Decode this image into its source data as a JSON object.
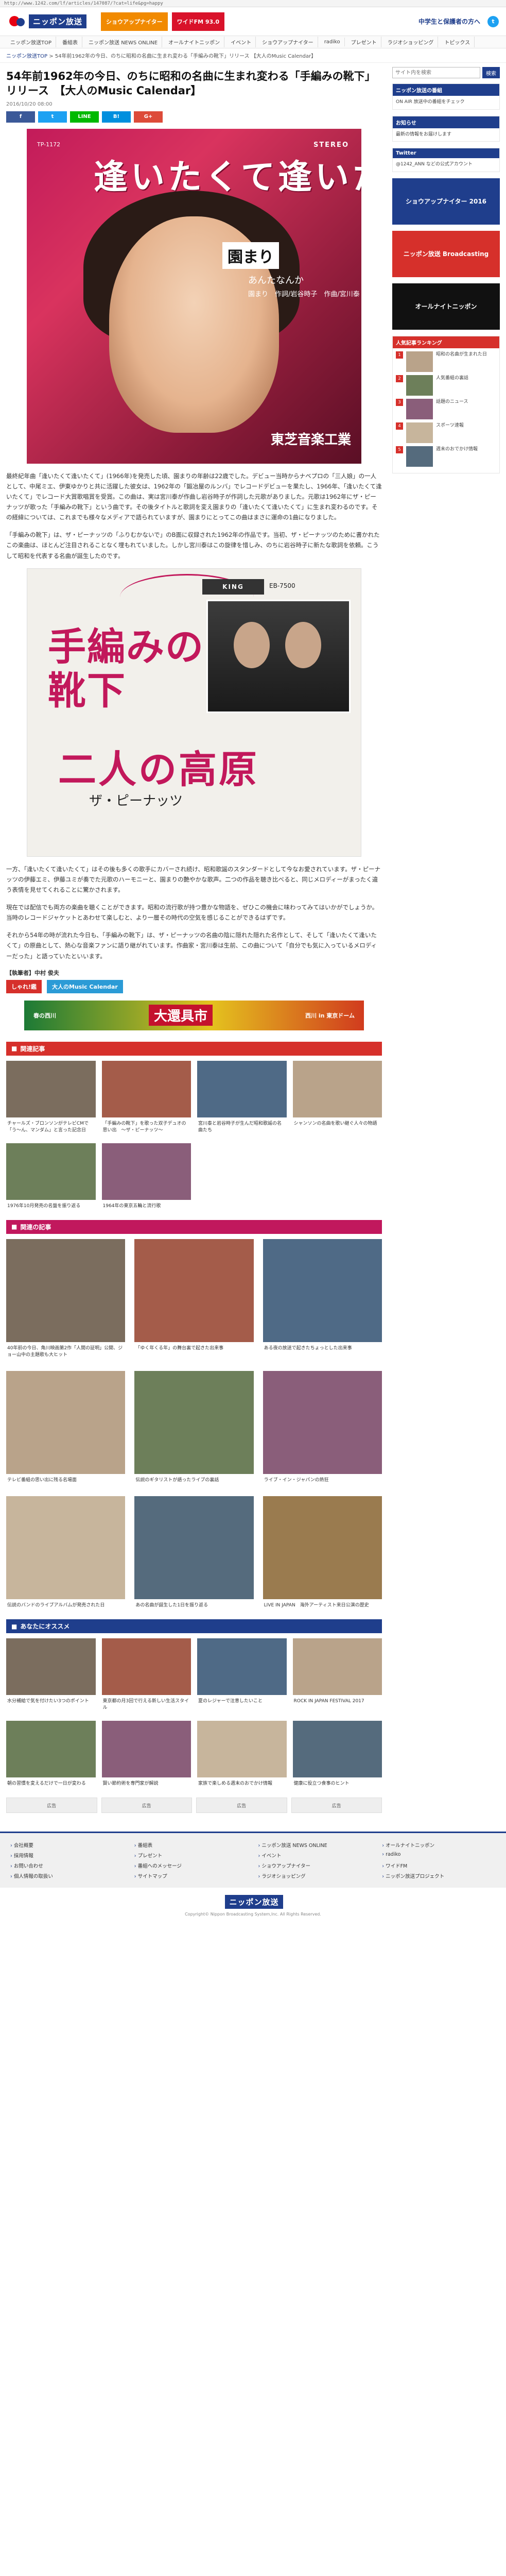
{
  "browser": {
    "url": "http://www.1242.com/lf/articles/147087/?cat=life&pg=happy"
  },
  "header": {
    "logo": "ニッポン放送",
    "banners": [
      {
        "text": "ショウアップナイター",
        "color": "#f18a00"
      },
      {
        "text": "ワイドFM 93.0",
        "color": "#d9122a"
      }
    ],
    "tagline": "中学生と保護者の方へ"
  },
  "nav": {
    "items": [
      "ニッポン放送TOP",
      "番組表",
      "ニッポン放送 NEWS ONLINE",
      "オールナイトニッポン",
      "イベント",
      "ショウアップナイター",
      "radiko",
      "プレゼント",
      "ラジオショッピング",
      "トピックス"
    ]
  },
  "breadcrumb": {
    "home": "ニッポン放送TOP",
    "sep": " > ",
    "current": "54年前1962年の今日、のちに昭和の名曲に生まれ変わる「手編みの靴下」リリース 【大人のMusic Calendar】"
  },
  "article": {
    "title": "54年前1962年の今日、のちに昭和の名曲に生まれ変わる「手編みの靴下」リリース　【大人のMusic Calendar】",
    "date": "2016/10/20 08:00",
    "share": [
      {
        "label": "f",
        "color": "#3b5998"
      },
      {
        "label": "t",
        "color": "#1da1f2"
      },
      {
        "label": "LINE",
        "color": "#00b900"
      },
      {
        "label": "B!",
        "color": "#008fde"
      },
      {
        "label": "G+",
        "color": "#dd4b39"
      }
    ],
    "sleeve1": {
      "title": "逢いたくて逢いたくて",
      "artist": "園まり",
      "sub": "あんたなんか",
      "credit": "園まり　作詞/岩谷時子　作曲/宮川泰",
      "label": "東芝音楽工業",
      "stereo": "STEREO",
      "catalog": "TP-1172"
    },
    "para1": "最終紀年曲「逢いたくて逢いたくて」(1966年)を発売した頃、園まりの年齢は22歳でした。デビュー当時からナベプロの「三人娘」の一人として、中尾ミエ、伊東ゆかりと共に活躍した彼女は、1962年の「鍛冶屋のルンバ」でレコードデビューを果たし、1966年、「逢いたくて逢いたくて」でレコード大賞歌唱賞を受賞。この曲は、実は宮川泰が作曲し岩谷時子が作詞した元歌がありました。元歌は1962年にザ・ピーナッツが歌った「手編みの靴下」という曲です。その後タイトルと歌詞を変え園まりの「逢いたくて逢いたくて」に生まれ変わるのです。その経緯については、これまでも様々なメディアで語られていますが、園まりにとってこの曲はまさに運命の1曲になりました。",
    "para2": "「手編みの靴下」は、ザ・ピーナッツの「ふりむかないで」のB面に収録された1962年の作品です。当初、ザ・ピーナッツのために書かれたこの楽曲は、ほとんど注目されることなく埋もれていました。しかし宮川泰はこの旋律を惜しみ、のちに岩谷時子に新たな歌詞を依頼。こうして昭和を代表する名曲が誕生したのです。",
    "sleeve2": {
      "title_top": "手編みの",
      "title_mid": "靴下",
      "title_bottom": "二人の高原",
      "artist": "ザ・ピーナッツ",
      "logo": "KING",
      "catalog": "EB-7500"
    },
    "para3": "一方、「逢いたくて逢いたくて」はその後も多くの歌手にカバーされ続け、昭和歌謡のスタンダードとして今なお愛されています。ザ・ピーナッツの伊藤エミ、伊藤ユミが奏でた元歌のハーモニーと、園まりの艶やかな歌声。二つの作品を聴き比べると、同じメロディーがまったく違う表情を見せてくれることに驚かされます。",
    "para4": "現在では配信でも両方の楽曲を聴くことができます。昭和の流行歌が持つ豊かな物語を、ぜひこの機会に味わってみてはいかがでしょうか。当時のレコードジャケットとあわせて楽しむと、より一層その時代の空気を感じることができるはずです。",
    "para5": "それから54年の時が流れた今日も、「手編みの靴下」は、ザ・ピーナッツの名曲の陰に隠れた隠れた名作として、そして「逢いたくて逢いたくて」の原曲として、熱心な音楽ファンに語り継がれています。作曲家・宮川泰は生前、この曲について「自分でも気に入っているメロディーだった」と語っていたといいます。",
    "staff": "【執筆者】中村 俊夫",
    "logos": [
      {
        "text": "しゃれ!鑑",
        "color": "#d6302b"
      },
      {
        "text": "大人のMusic Calendar",
        "color": "#2b9bd6"
      }
    ]
  },
  "wide_ad": {
    "left": "春の西川",
    "big": "大還具市",
    "right": "西川 in 東京ドーム"
  },
  "sections": [
    {
      "title": "関連記事",
      "style": "red",
      "cards": [
        {
          "cap": "チャールズ・ブロンソンがテレビCMで「う～ん、マンダム」と言った記念日"
        },
        {
          "cap": "「手編みの靴下」を歌った双子デュオの思い出　～ザ・ピーナッツ～"
        },
        {
          "cap": "宮川泰と岩谷時子が生んだ昭和歌謡の名曲たち"
        },
        {
          "cap": "シャンソンの名曲を歌い継ぐ人々の物語"
        },
        {
          "cap": "1976年10月発売の名盤を振り返る"
        },
        {
          "cap": "1964年の東京五輪と流行歌"
        }
      ]
    }
  ],
  "popular": {
    "title": "関連の記事",
    "cards": [
      {
        "cap": "40年前の今日、角川映画第2作「人間の証明」公開、ジョー山中の主題歌も大ヒット"
      },
      {
        "cap": "「ゆく年くる年」の舞台裏で起きた出来事"
      },
      {
        "cap": "ある夜の放送で起きたちょっとした出来事"
      },
      {
        "cap": "テレビ番組の思い出に残る名場面"
      },
      {
        "cap": "伝説のギタリストが語ったライブの裏話"
      },
      {
        "cap": "ライブ・イン・ジャパンの熱狂"
      },
      {
        "cap": "伝説のバンドのライブアルバムが発売された日"
      },
      {
        "cap": "あの名曲が誕生した1日を振り返る"
      },
      {
        "cap": "LIVE IN JAPAN　海外アーティスト来日公演の歴史"
      }
    ]
  },
  "recommend": {
    "title": "あなたにオススメ",
    "cards": [
      {
        "cap": "水分補給で気を付けたい3つのポイント"
      },
      {
        "cap": "東京都の月3回で行える新しい生活スタイル"
      },
      {
        "cap": "夏のレジャーで注意したいこと"
      },
      {
        "cap": "ROCK IN JAPAN FESTIVAL 2017"
      },
      {
        "cap": "朝の習慣を変えるだけで一日が変わる"
      },
      {
        "cap": "賢い節約術を専門家が解説"
      },
      {
        "cap": "家族で楽しめる週末のおでかけ情報"
      },
      {
        "cap": "健康に役立つ食事のヒント"
      }
    ]
  },
  "ads_bottom": [
    "広告",
    "広告",
    "広告",
    "広告"
  ],
  "sidebar": {
    "search_placeholder": "サイト内を検索",
    "search_button": "検索",
    "blocks": [
      {
        "head": "ニッポン放送の番組",
        "body": "ON AIR 放送中の番組をチェック"
      },
      {
        "head": "お知らせ",
        "body": "最新の情報をお届けします"
      },
      {
        "head": "Twitter",
        "body": "@1242_ANN などの公式アカウント"
      }
    ],
    "banners": [
      {
        "text": "ショウアップナイター 2016",
        "color": "#1f3e8c"
      },
      {
        "text": "ニッポン放送 Broadcasting",
        "color": "#d6302b"
      },
      {
        "text": "オールナイトニッポン",
        "color": "#111"
      }
    ],
    "ranking_title": "人気記事ランキング",
    "ranking": [
      "昭和の名曲が生まれた日",
      "人気番組の裏話",
      "話題のニュース",
      "スポーツ速報",
      "週末のおでかけ情報"
    ]
  },
  "footer": {
    "links": [
      "会社概要",
      "番組表",
      "ニッポン放送 NEWS ONLINE",
      "オールナイトニッポン",
      "採用情報",
      "プレゼント",
      "イベント",
      "radiko",
      "お問い合わせ",
      "番組へのメッセージ",
      "ショウアップナイター",
      "ワイドFM",
      "個人情報の取扱い",
      "サイトマップ",
      "ラジオショッピング",
      "ニッポン放送プロジェクト"
    ],
    "logo": "ニッポン放送",
    "copyright": "Copyright© Nippon Broadcasting System,Inc. All Rights Reserved."
  }
}
